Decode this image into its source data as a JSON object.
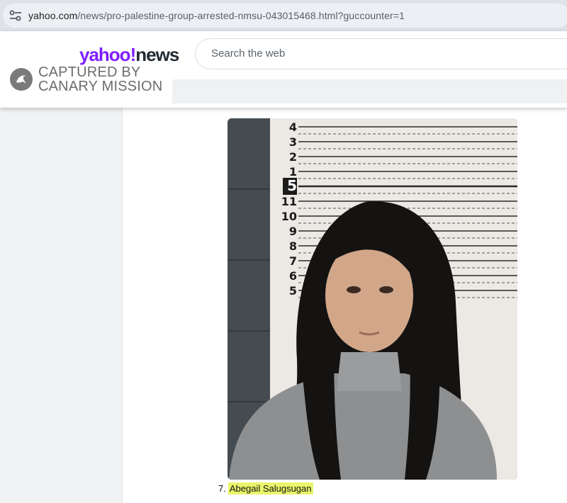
{
  "browser": {
    "url_host": "yahoo.com",
    "url_path": "/news/pro-palestine-group-arrested-nmsu-043015468.html?guccounter=1"
  },
  "header": {
    "logo_yahoo": "yahoo",
    "logo_bang": "!",
    "logo_news": "news",
    "search_placeholder": "Search the web"
  },
  "watermark": {
    "line1": "CAPTURED BY",
    "line2": "CANARY MISSION",
    "icon": "canary-bird-icon"
  },
  "photo": {
    "height_chart_labels": [
      "4",
      "3",
      "2",
      "1",
      "5",
      "11",
      "10",
      "9",
      "8",
      "7",
      "6",
      "5"
    ]
  },
  "caption": {
    "number": "7.",
    "name": "Abegail Salugsugan"
  },
  "colors": {
    "yahoo_purple": "#7e1fff",
    "highlight": "#e9f56a"
  }
}
